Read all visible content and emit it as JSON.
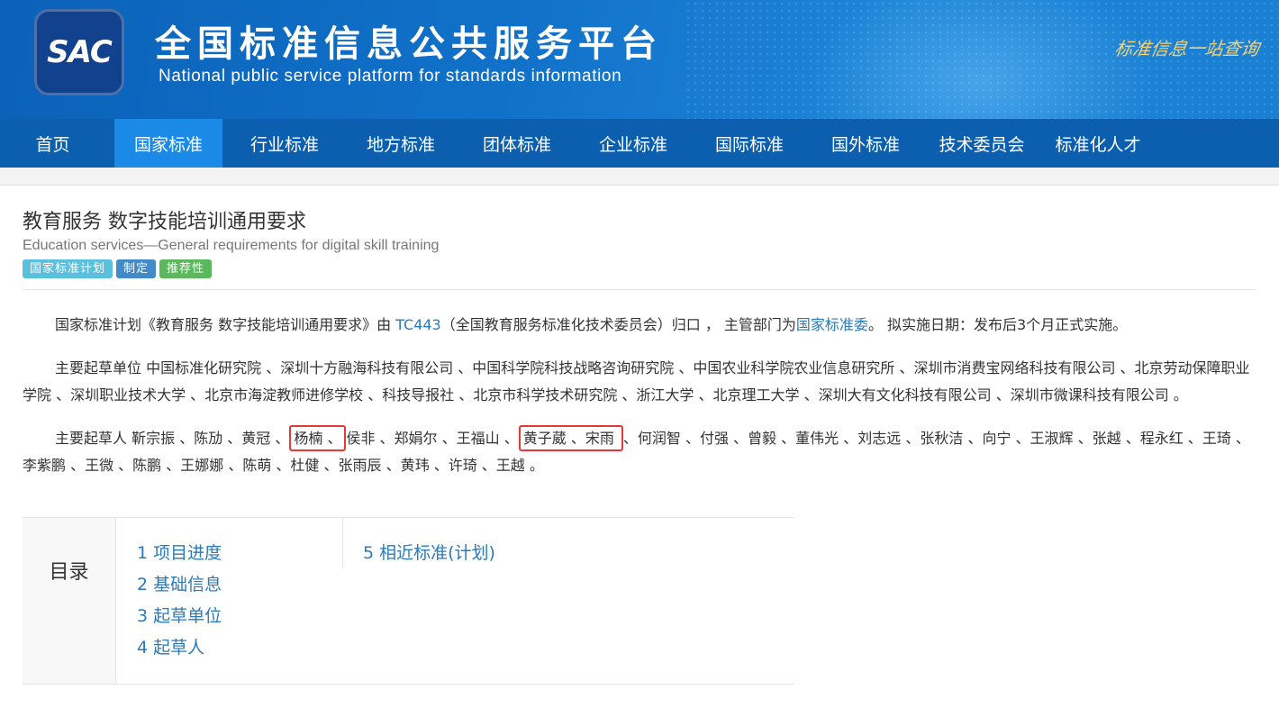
{
  "header": {
    "logo_text": "SAC",
    "title": "全国标准信息公共服务平台",
    "subtitle": "National public service platform  for standards information",
    "slogan": "标准信息一站查询"
  },
  "nav": [
    {
      "label": "首页",
      "active": false
    },
    {
      "label": "国家标准",
      "active": true
    },
    {
      "label": "行业标准",
      "active": false
    },
    {
      "label": "地方标准",
      "active": false
    },
    {
      "label": "团体标准",
      "active": false
    },
    {
      "label": "企业标准",
      "active": false
    },
    {
      "label": "国际标准",
      "active": false
    },
    {
      "label": "国外标准",
      "active": false
    },
    {
      "label": "技术委员会",
      "active": false
    },
    {
      "label": "标准化人才",
      "active": false
    }
  ],
  "standard": {
    "title_cn": "教育服务 数字技能培训通用要求",
    "title_en": "Education services—General requirements for digital skill training",
    "tags": {
      "plan": "国家标准计划",
      "make": "制定",
      "rec": "推荐性"
    }
  },
  "intro": {
    "p1_a": "国家标准计划《教育服务 数字技能培训通用要求》由 ",
    "tc_link": "TC443",
    "p1_b": "（全国教育服务标准化技术委员会）归口 ， 主管部门为",
    "dept_link": "国家标准委",
    "p1_c": "。 拟实施日期：发布后3个月正式实施。"
  },
  "units": {
    "label": "主要起草单位",
    "text": " 中国标准化研究院 、深圳十方融海科技有限公司 、中国科学院科技战略咨询研究院 、中国农业科学院农业信息研究所 、深圳市消费宝网络科技有限公司 、北京劳动保障职业学院 、深圳职业技术大学 、北京市海淀教师进修学校 、科技导报社 、北京市科学技术研究院 、浙江大学 、北京理工大学 、深圳大有文化科技有限公司 、深圳市微课科技有限公司 。"
  },
  "drafters": {
    "label": "主要起草人",
    "before": " 靳宗振 、陈劢 、黄冠 、",
    "boxed1": "杨楠 、",
    "middle": "侯非 、郑娟尔 、王福山 、",
    "boxed2": "黄子葳 、宋雨 ",
    "after": "、何润智 、付强 、曾毅 、董伟光 、刘志远 、张秋洁 、向宁 、王淑辉 、张越 、程永红 、王琦 、李紫鹏 、王微 、陈鹏 、王娜娜 、陈萌 、杜健 、张雨辰 、黄玮 、许琦 、王越 。"
  },
  "toc": {
    "label": "目录",
    "col1": [
      "1  项目进度",
      "2  基础信息",
      "3  起草单位",
      "4  起草人"
    ],
    "col2": [
      "5  相近标准(计划)"
    ]
  }
}
